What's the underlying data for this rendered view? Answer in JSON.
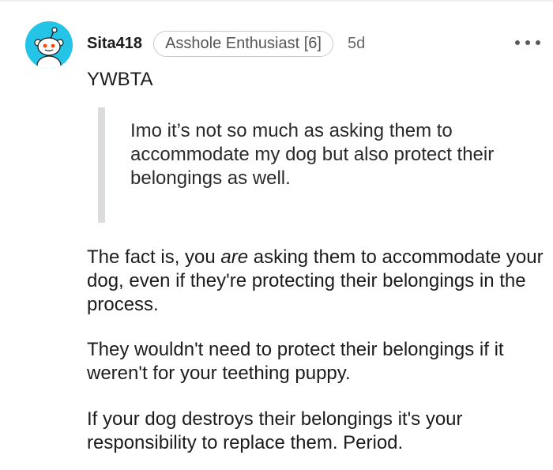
{
  "comment": {
    "username": "Sita418",
    "flair": "Asshole Enthusiast [6]",
    "age": "5d",
    "more_label": "•••",
    "verdict": "YWBTA",
    "quote": "Imo it’s not so much as asking them to accommodate my dog but also protect their belongings as well.",
    "paragraph1_before": "The fact is, you ",
    "paragraph1_emphasis": "are",
    "paragraph1_after": " asking them to accommodate your dog, even if they're protecting their belongings in the process.",
    "paragraph2": "They wouldn't need to protect their belongings if it weren't for your teething puppy.",
    "paragraph3": "If your dog destroys their belongings it's your responsibility to replace them. Period."
  },
  "colors": {
    "avatar_bg": "#24c4e6",
    "text": "#1c1c1c",
    "quote_bar": "#dadcde"
  },
  "icons": {
    "avatar": "snoo-avatar-icon",
    "more": "more-options-icon"
  }
}
